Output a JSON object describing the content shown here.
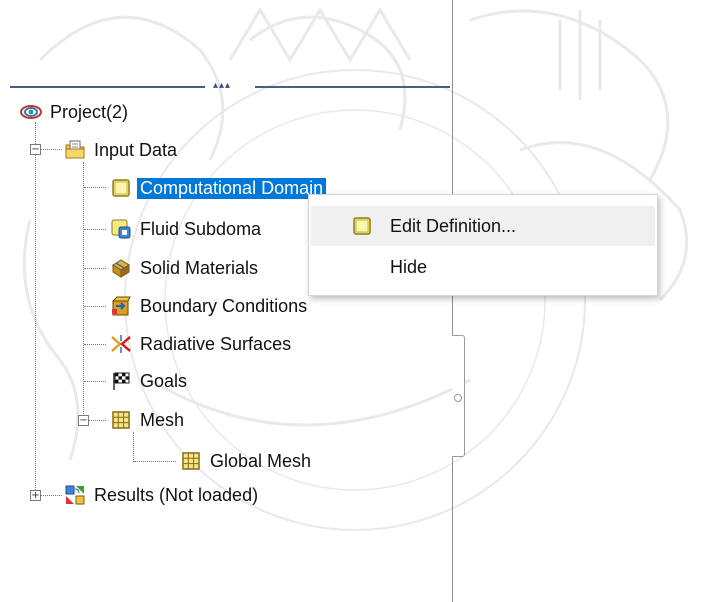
{
  "tree": {
    "project": {
      "label": "Project(2)",
      "icon": "project-icon"
    },
    "input_data": {
      "label": "Input Data",
      "icon": "folder-input-icon",
      "expander": "−"
    },
    "computational_domain": {
      "label": "Computational Domain",
      "icon": "domain-box-icon"
    },
    "fluid_subdomains": {
      "label": "Fluid Subdoma",
      "icon": "fluid-subdomain-icon"
    },
    "solid_materials": {
      "label": "Solid Materials",
      "icon": "solid-materials-icon"
    },
    "boundary_conditions": {
      "label": "Boundary Conditions",
      "icon": "boundary-conditions-icon"
    },
    "radiative_surfaces": {
      "label": "Radiative Surfaces",
      "icon": "radiative-surfaces-icon"
    },
    "goals": {
      "label": "Goals",
      "icon": "goals-flag-icon"
    },
    "mesh": {
      "label": "Mesh",
      "icon": "mesh-icon",
      "expander": "−"
    },
    "global_mesh": {
      "label": "Global Mesh",
      "icon": "mesh-icon"
    },
    "results": {
      "label": "Results (Not loaded)",
      "icon": "results-icon",
      "expander": "+"
    }
  },
  "context_menu": {
    "items": [
      {
        "label": "Edit Definition...",
        "icon": "domain-box-icon"
      },
      {
        "label": "Hide"
      }
    ]
  },
  "colors": {
    "selection": "#0078d7",
    "menu_hover": "#f0f0f0"
  }
}
